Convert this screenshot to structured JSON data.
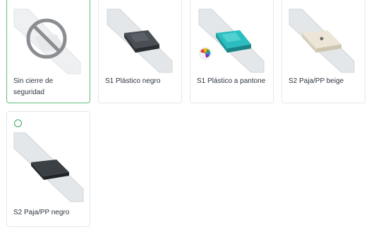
{
  "options": [
    {
      "label": "Sin cierre de seguridad",
      "selected": true,
      "icon": "no-closure-icon"
    },
    {
      "label": "S1 Plástico negro",
      "selected": false,
      "color": "#4a4f55"
    },
    {
      "label": "S1 Plástico a pantone",
      "selected": false,
      "color": "#2bbdbf",
      "icon": "color-wheel-icon"
    },
    {
      "label": "S2 Paja/PP beige",
      "selected": false,
      "color": "#ece6d8"
    },
    {
      "label": "S2 Paja/PP negro",
      "selected": false,
      "color": "#3b4045"
    }
  ],
  "colors": {
    "selected_border": "#5fbf7a",
    "card_border": "#e3e6ea",
    "text": "#2d3540"
  }
}
